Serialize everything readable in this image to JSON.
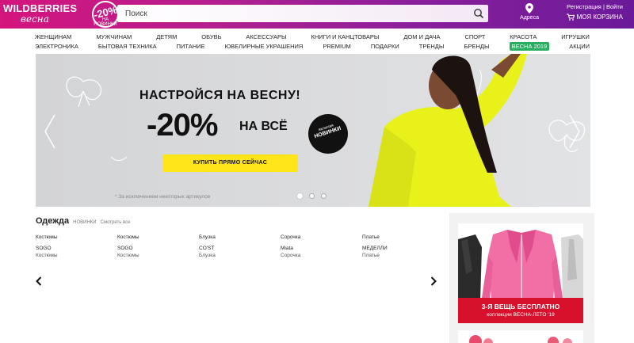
{
  "header": {
    "logo_text": "WILDBERRIES",
    "logo_sub": "весна",
    "promo_badge": "-20%",
    "promo_badge_sub": "НА НОВИНКИ",
    "search_placeholder": "Поиск",
    "address_label": "Адреса",
    "register_link": "Регистрация",
    "divider": "|",
    "login_link": "Войти",
    "cart_label": "МОЯ КОРЗИНА",
    "colors": {
      "gradient_start": "#d5147d",
      "gradient_end": "#6a1a99"
    }
  },
  "nav": {
    "row1": [
      "ЖЕНЩИНАМ",
      "МУЖЧИНАМ",
      "ДЕТЯМ",
      "ОБУВЬ",
      "АКСЕССУАРЫ",
      "КНИГИ И КАНЦТОВАРЫ",
      "ДОМ И ДАЧА",
      "СПОРТ",
      "КРАСОТА",
      "ИГРУШКИ"
    ],
    "row2": [
      "ЭЛЕКТРОНИКА",
      "БЫТОВАЯ ТЕХНИКА",
      "ПИТАНИЕ",
      "ЮВЕЛИРНЫЕ УКРАШЕНИЯ",
      "PREMIUM",
      "ПОДАРКИ",
      "ТРЕНДЫ",
      "БРЕНДЫ",
      "ВЕСНА 2019",
      "АКЦИИ"
    ],
    "highlight_color": "#27ae60"
  },
  "banner": {
    "title": "НАСТРОЙСЯ НА ВЕСНУ!",
    "discount": "-20%",
    "discount_suffix": "НА ВСЁ",
    "sticker_top": "включая",
    "sticker_main": "НОВИНКИ",
    "cta": "КУПИТЬ ПРЯМО СЕЙЧАС",
    "note": "* За исключением некоторых артикулов",
    "cta_color": "#ffe41a",
    "accent_color": "#e8f21a",
    "slides": 3,
    "active_slide": 1
  },
  "clothes": {
    "title": "Одежда",
    "tab_new": "НОВИНКИ",
    "tab_all": "Смотреть все",
    "items": [
      {
        "category": "Костюмы",
        "brand": "SOGO",
        "kind": "Костюмы"
      },
      {
        "category": "Костюмы",
        "brand": "SOGO",
        "kind": "Костюмы"
      },
      {
        "category": "Блузка",
        "brand": "CO'ST",
        "kind": "Блузка"
      },
      {
        "category": "Сорочка",
        "brand": "Miata",
        "kind": "Сорочка"
      },
      {
        "category": "Платье",
        "brand": "МЕДЕЛЛИ",
        "kind": "Платье"
      }
    ]
  },
  "side_ad": {
    "headline": "3-Я ВЕЩЬ БЕСПЛАТНО",
    "subline": "коллекции ВЕСНА-ЛЕТО '19",
    "bar_color": "#d7102b"
  },
  "icons": [
    "search-icon",
    "map-pin-icon",
    "cart-icon",
    "chevron-left-icon",
    "chevron-right-icon",
    "butterfly-icon"
  ]
}
